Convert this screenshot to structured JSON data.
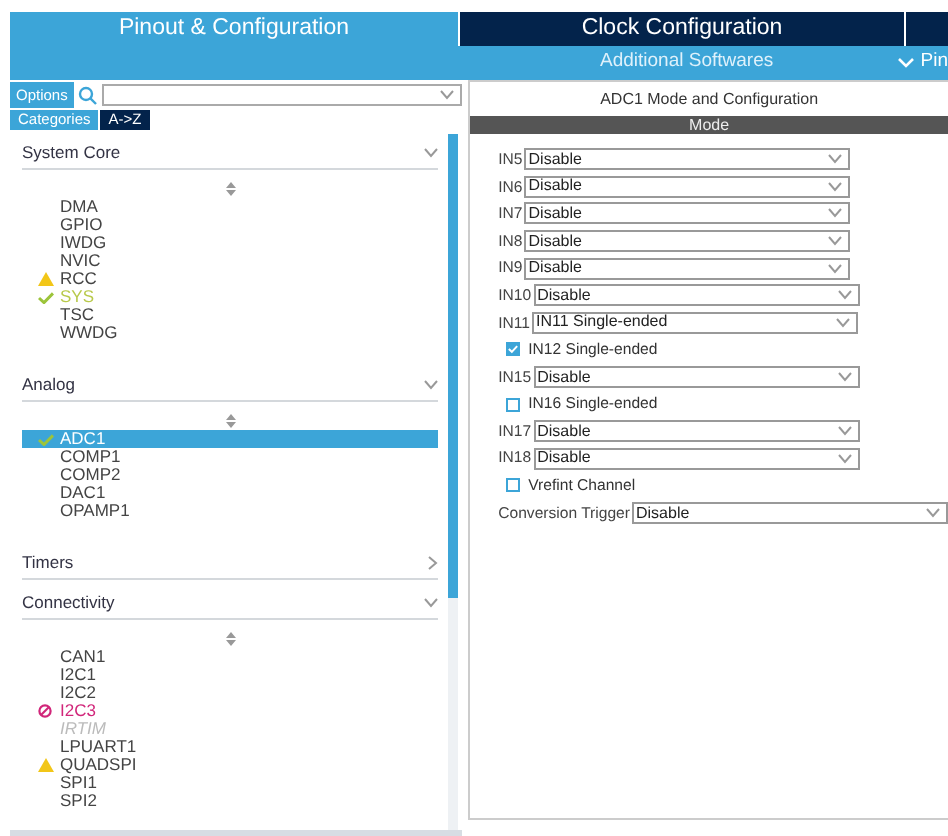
{
  "tabs": [
    {
      "label": "Pinout & Configuration",
      "selected": true
    },
    {
      "label": "Clock Configuration",
      "selected": false
    },
    {
      "selected": false
    }
  ],
  "subbar": {
    "label": "Additional Softwares",
    "right": "Pin"
  },
  "left": {
    "options_button": "Options",
    "view_tabs": [
      {
        "label": "Categories",
        "selected": true
      },
      {
        "label": "A->Z",
        "selected": false
      }
    ],
    "sections": [
      {
        "title": "System Core",
        "expanded": true,
        "items": [
          {
            "label": "DMA",
            "kind": "plain",
            "selected": false
          },
          {
            "label": "GPIO",
            "kind": "plain",
            "selected": false
          },
          {
            "label": "IWDG",
            "kind": "plain",
            "selected": false
          },
          {
            "label": "NVIC",
            "kind": "plain",
            "selected": false
          },
          {
            "label": "RCC",
            "kind": "warning",
            "selected": false
          },
          {
            "label": "SYS",
            "kind": "ok",
            "selected": false
          },
          {
            "label": "TSC",
            "kind": "plain",
            "selected": false
          },
          {
            "label": "WWDG",
            "kind": "plain",
            "selected": false
          }
        ]
      },
      {
        "title": "Analog",
        "expanded": true,
        "items": [
          {
            "label": "ADC1",
            "kind": "ok",
            "selected": true
          },
          {
            "label": "COMP1",
            "kind": "plain",
            "selected": false
          },
          {
            "label": "COMP2",
            "kind": "plain",
            "selected": false
          },
          {
            "label": "DAC1",
            "kind": "plain",
            "selected": false
          },
          {
            "label": "OPAMP1",
            "kind": "plain",
            "selected": false
          }
        ]
      },
      {
        "title": "Timers",
        "expanded": false
      },
      {
        "title": "Connectivity",
        "expanded": true,
        "items": [
          {
            "label": "CAN1",
            "kind": "plain",
            "selected": false
          },
          {
            "label": "I2C1",
            "kind": "plain",
            "selected": false
          },
          {
            "label": "I2C2",
            "kind": "plain",
            "selected": false
          },
          {
            "label": "I2C3",
            "kind": "error",
            "selected": false
          },
          {
            "label": "IRTIM",
            "kind": "disabled",
            "selected": false
          },
          {
            "label": "LPUART1",
            "kind": "plain",
            "selected": false
          },
          {
            "label": "QUADSPI",
            "kind": "warning",
            "selected": false
          },
          {
            "label": "SPI1",
            "kind": "plain",
            "selected": false
          },
          {
            "label": "SPI2",
            "kind": "plain",
            "selected": false
          }
        ]
      }
    ]
  },
  "right": {
    "title": "ADC1 Mode and Configuration",
    "header": "Mode",
    "rows": [
      {
        "kind": "select",
        "label": "IN5",
        "value": "Disable"
      },
      {
        "kind": "select",
        "label": "IN6",
        "value": "Disable"
      },
      {
        "kind": "select",
        "label": "IN7",
        "value": "Disable"
      },
      {
        "kind": "select",
        "label": "IN8",
        "value": "Disable"
      },
      {
        "kind": "select",
        "label": "IN9",
        "value": "Disable"
      },
      {
        "kind": "select",
        "label": "IN10",
        "value": "Disable"
      },
      {
        "kind": "select",
        "label": "IN11",
        "value": "IN11 Single-ended"
      },
      {
        "kind": "check",
        "label": "IN12 Single-ended",
        "checked": true
      },
      {
        "kind": "select",
        "label": "IN15",
        "value": "Disable"
      },
      {
        "kind": "check",
        "label": "IN16 Single-ended",
        "checked": false
      },
      {
        "kind": "select",
        "label": "IN17",
        "value": "Disable"
      },
      {
        "kind": "select",
        "label": "IN18",
        "value": "Disable"
      },
      {
        "kind": "check",
        "label": "Vrefint Channel",
        "checked": false
      },
      {
        "kind": "wide",
        "label": "Conversion Trigger",
        "value": "Disable"
      }
    ]
  }
}
